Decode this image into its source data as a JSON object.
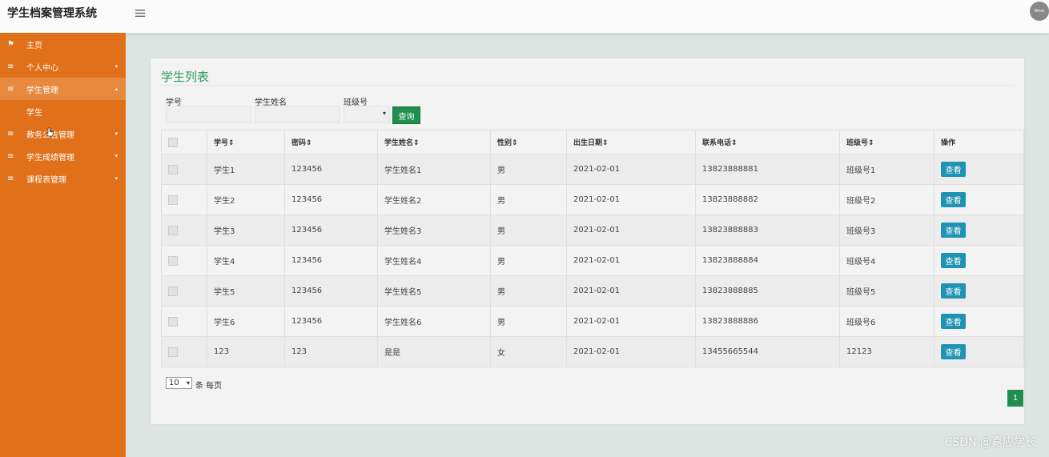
{
  "header": {
    "title": "学生档案管理系统",
    "menu_icon": "hamburger-icon",
    "avatar_text": "Wnm"
  },
  "sidebar": {
    "items": [
      {
        "label": "主页",
        "icon": "flag-icon",
        "icon_glyph": "⚑",
        "arrow": ""
      },
      {
        "label": "个人中心",
        "icon": "list-icon",
        "icon_glyph": "≡",
        "arrow": "▾"
      },
      {
        "label": "学生管理",
        "icon": "list-icon",
        "icon_glyph": "≡",
        "arrow": "▴",
        "open": true,
        "children": [
          "学生"
        ]
      },
      {
        "label": "教务公告管理",
        "icon": "list-icon",
        "icon_glyph": "≡",
        "arrow": "▾"
      },
      {
        "label": "学生成绩管理",
        "icon": "list-icon",
        "icon_glyph": "≡",
        "arrow": "▾"
      },
      {
        "label": "课程表管理",
        "icon": "list-icon",
        "icon_glyph": "≡",
        "arrow": "▾"
      }
    ]
  },
  "panel": {
    "title": "学生列表",
    "filters": {
      "student_no_label": "学号",
      "student_name_label": "学生姓名",
      "class_no_label": "班级号",
      "query_label": "查询"
    },
    "table": {
      "columns": [
        "学号",
        "密码",
        "学生姓名",
        "性别",
        "出生日期",
        "联系电话",
        "班级号",
        "操作"
      ],
      "sort_glyph": "⇕",
      "action_label": "查看",
      "rows": [
        [
          "学生1",
          "123456",
          "学生姓名1",
          "男",
          "2021-02-01",
          "13823888881",
          "班级号1"
        ],
        [
          "学生2",
          "123456",
          "学生姓名2",
          "男",
          "2021-02-01",
          "13823888882",
          "班级号2"
        ],
        [
          "学生3",
          "123456",
          "学生姓名3",
          "男",
          "2021-02-01",
          "13823888883",
          "班级号3"
        ],
        [
          "学生4",
          "123456",
          "学生姓名4",
          "男",
          "2021-02-01",
          "13823888884",
          "班级号4"
        ],
        [
          "学生5",
          "123456",
          "学生姓名5",
          "男",
          "2021-02-01",
          "13823888885",
          "班级号5"
        ],
        [
          "学生6",
          "123456",
          "学生姓名6",
          "男",
          "2021-02-01",
          "13823888886",
          "班级号6"
        ],
        [
          "123",
          "123",
          "是是",
          "女",
          "2021-02-01",
          "13455665544",
          "12123"
        ]
      ]
    },
    "pagination": {
      "page_size": "10",
      "per_page_text": "条 每页",
      "current_page": "1"
    }
  },
  "watermark": "CSDN @嘉应学长",
  "colors": {
    "sidebar": "#e0701a",
    "sidebar_open": "#e78a40",
    "primary_green": "#1e8f4e",
    "view_button": "#1e93b3",
    "title_green": "#2a9a5a"
  }
}
